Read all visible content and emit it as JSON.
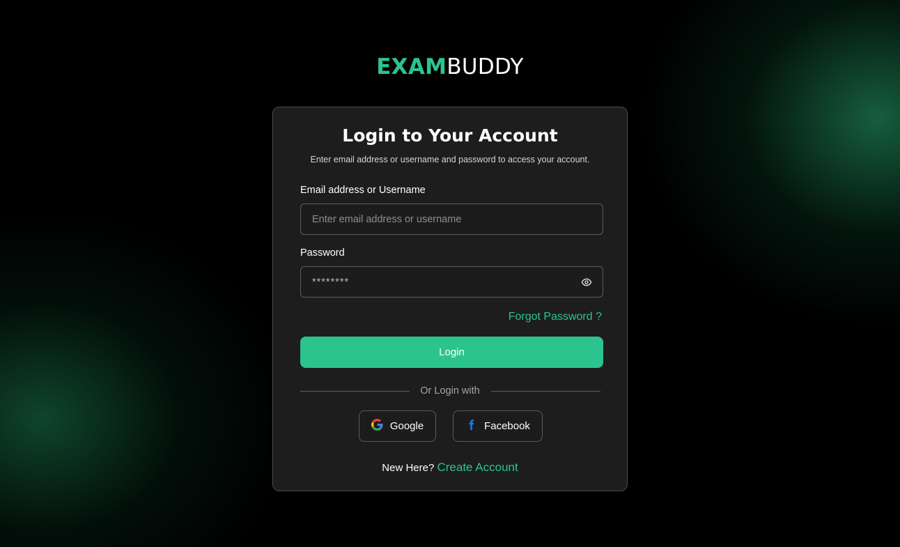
{
  "logo": {
    "part1": "EXAM",
    "part2": "BUDDY"
  },
  "card": {
    "title": "Login to Your Account",
    "subtitle": "Enter email address or username and password to access your account.",
    "email": {
      "label": "Email address or Username",
      "placeholder": "Enter email address or username",
      "value": ""
    },
    "password": {
      "label": "Password",
      "value": "********",
      "toggle_icon": "eye-icon"
    },
    "forgot_label": "Forgot Password ?",
    "login_label": "Login",
    "divider_text": "Or Login with",
    "social": [
      {
        "label": "Google",
        "icon": "google-icon"
      },
      {
        "label": "Facebook",
        "icon": "facebook-icon"
      }
    ],
    "footer": {
      "prompt": "New Here?",
      "link": "Create Account"
    }
  },
  "colors": {
    "accent": "#2cc48e",
    "background": "#000000",
    "card": "#1c1d1c",
    "facebook": "#1877f2"
  }
}
